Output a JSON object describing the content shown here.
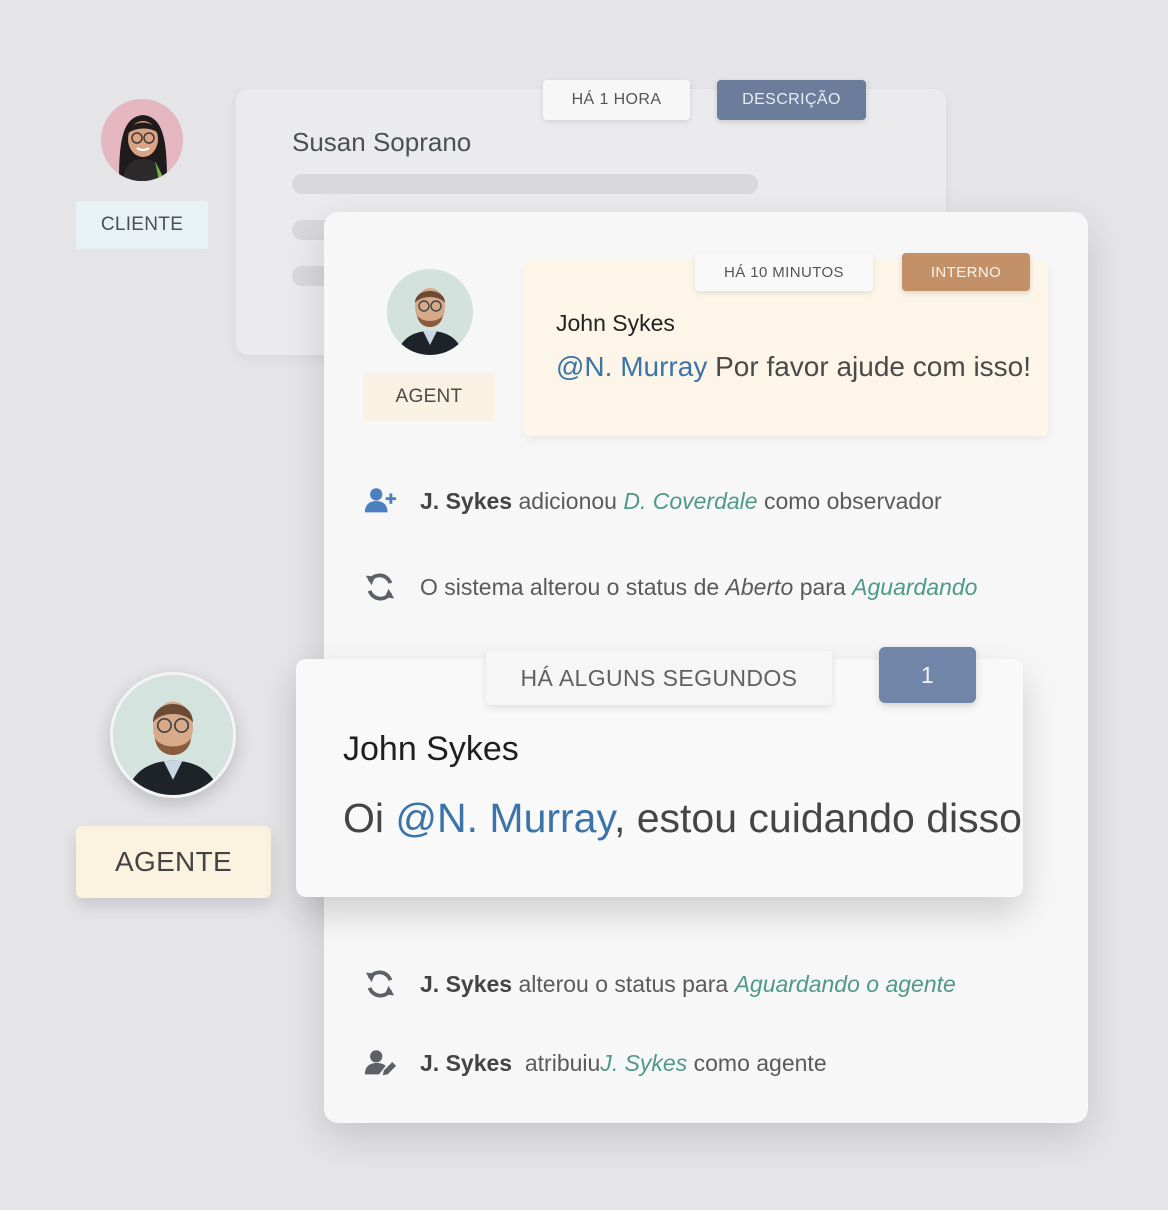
{
  "customer": {
    "role": "CLIENTE",
    "name": "Susan Soprano",
    "time": "HÁ 1 HORA",
    "type": "DESCRIÇÃO"
  },
  "internal_note": {
    "role": "AGENT",
    "time": "HÁ 10 MINUTOS",
    "type": "INTERNO",
    "author": "John Sykes",
    "mention": "@N. Murray",
    "text": " Por favor ajude com isso!"
  },
  "activities": [
    {
      "icon": "user-plus-icon",
      "actor": "J. Sykes",
      "verb": " adicionou ",
      "target": "D. Coverdale",
      "suffix": " como observador"
    },
    {
      "icon": "refresh-icon",
      "prefix": "O sistema alterou o status de ",
      "from": "Aberto",
      "middle": " para ",
      "to": "Aguardando"
    },
    {
      "icon": "refresh-icon",
      "actor": "J. Sykes",
      "verb": " alterou o status para ",
      "target": "Aguardando o agente"
    },
    {
      "icon": "user-edit-icon",
      "actor": "J. Sykes",
      "verb": "  atribuiu",
      "target": "J. Sykes",
      "suffix": " como agente"
    }
  ],
  "latest_reply": {
    "role": "AGENTE",
    "time": "HÁ ALGUNS SEGUNDOS",
    "count": "1",
    "author": "John Sykes",
    "prefix": "Oi ",
    "mention": "@N. Murray",
    "text": ", estou cuidando disso"
  },
  "colors": {
    "mention": "#3a74a9",
    "status_green": "#4f9a86",
    "description_tag": "#6c7d9c",
    "internal_tag": "#c39067",
    "count_tag": "#7085a7",
    "note_background": "#fdf6e8"
  }
}
